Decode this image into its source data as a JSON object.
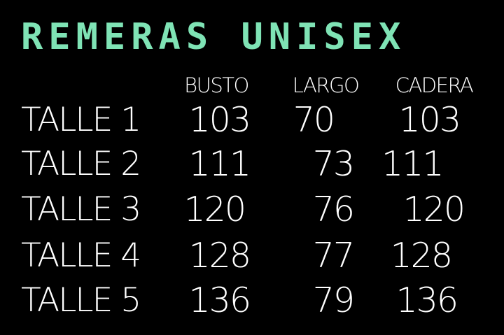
{
  "title": "REMERAS UNISEX",
  "colors": {
    "title": "#7fe3b5",
    "text": "#ffffff",
    "background": "#000000"
  },
  "columns": [
    "BUSTO",
    "LARGO",
    "CADERA"
  ],
  "rows": [
    {
      "label": "TALLE 1",
      "busto": "103",
      "largo": "70",
      "cadera": "103"
    },
    {
      "label": "TALLE 2",
      "busto": "111",
      "largo": "73",
      "cadera": "111"
    },
    {
      "label": "TALLE 3",
      "busto": "120",
      "largo": "76",
      "cadera": "120"
    },
    {
      "label": "TALLE 4",
      "busto": "128",
      "largo": "77",
      "cadera": "128"
    },
    {
      "label": "TALLE 5",
      "busto": "136",
      "largo": "79",
      "cadera": "136"
    }
  ]
}
